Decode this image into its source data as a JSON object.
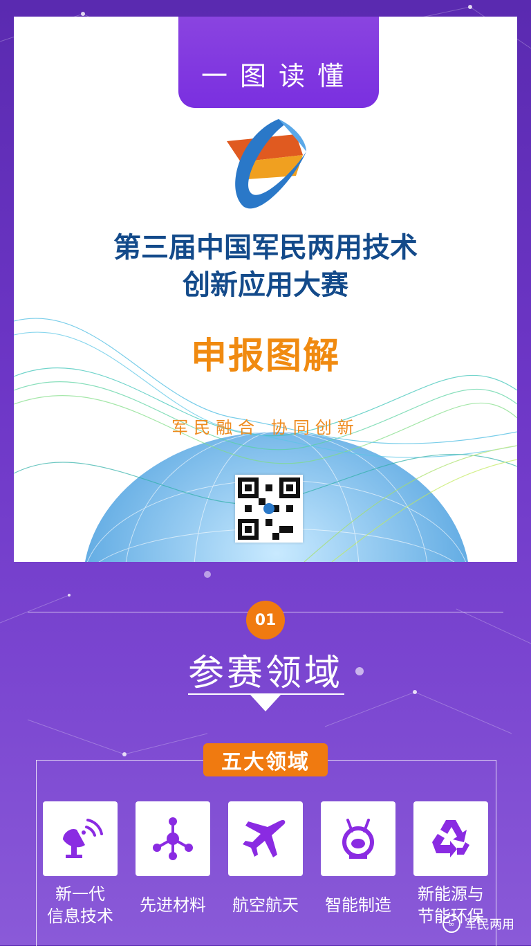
{
  "header": {
    "tab_title": "一图读懂"
  },
  "poster": {
    "title_line1": "第三届中国军民两用技术",
    "title_line2": "创新应用大赛",
    "subtitle": "申报图解",
    "slogan": "军民融合  协同创新"
  },
  "section": {
    "number": "01",
    "title": "参赛领域",
    "group_label": "五大领域",
    "fields": [
      {
        "label_line1": "新一代",
        "label_line2": "信息技术",
        "icon": "satellite-dish-icon"
      },
      {
        "label_line1": "先进材料",
        "label_line2": "",
        "icon": "molecule-icon"
      },
      {
        "label_line1": "航空航天",
        "label_line2": "",
        "icon": "airplane-icon"
      },
      {
        "label_line1": "智能制造",
        "label_line2": "",
        "icon": "robot-icon"
      },
      {
        "label_line1": "新能源与",
        "label_line2": "节能环保",
        "icon": "recycle-icon"
      }
    ]
  },
  "watermark": {
    "text": "军民两用"
  },
  "colors": {
    "accent_purple": "#7a2fe0",
    "orange": "#f07a10",
    "title_blue": "#134a8a"
  }
}
